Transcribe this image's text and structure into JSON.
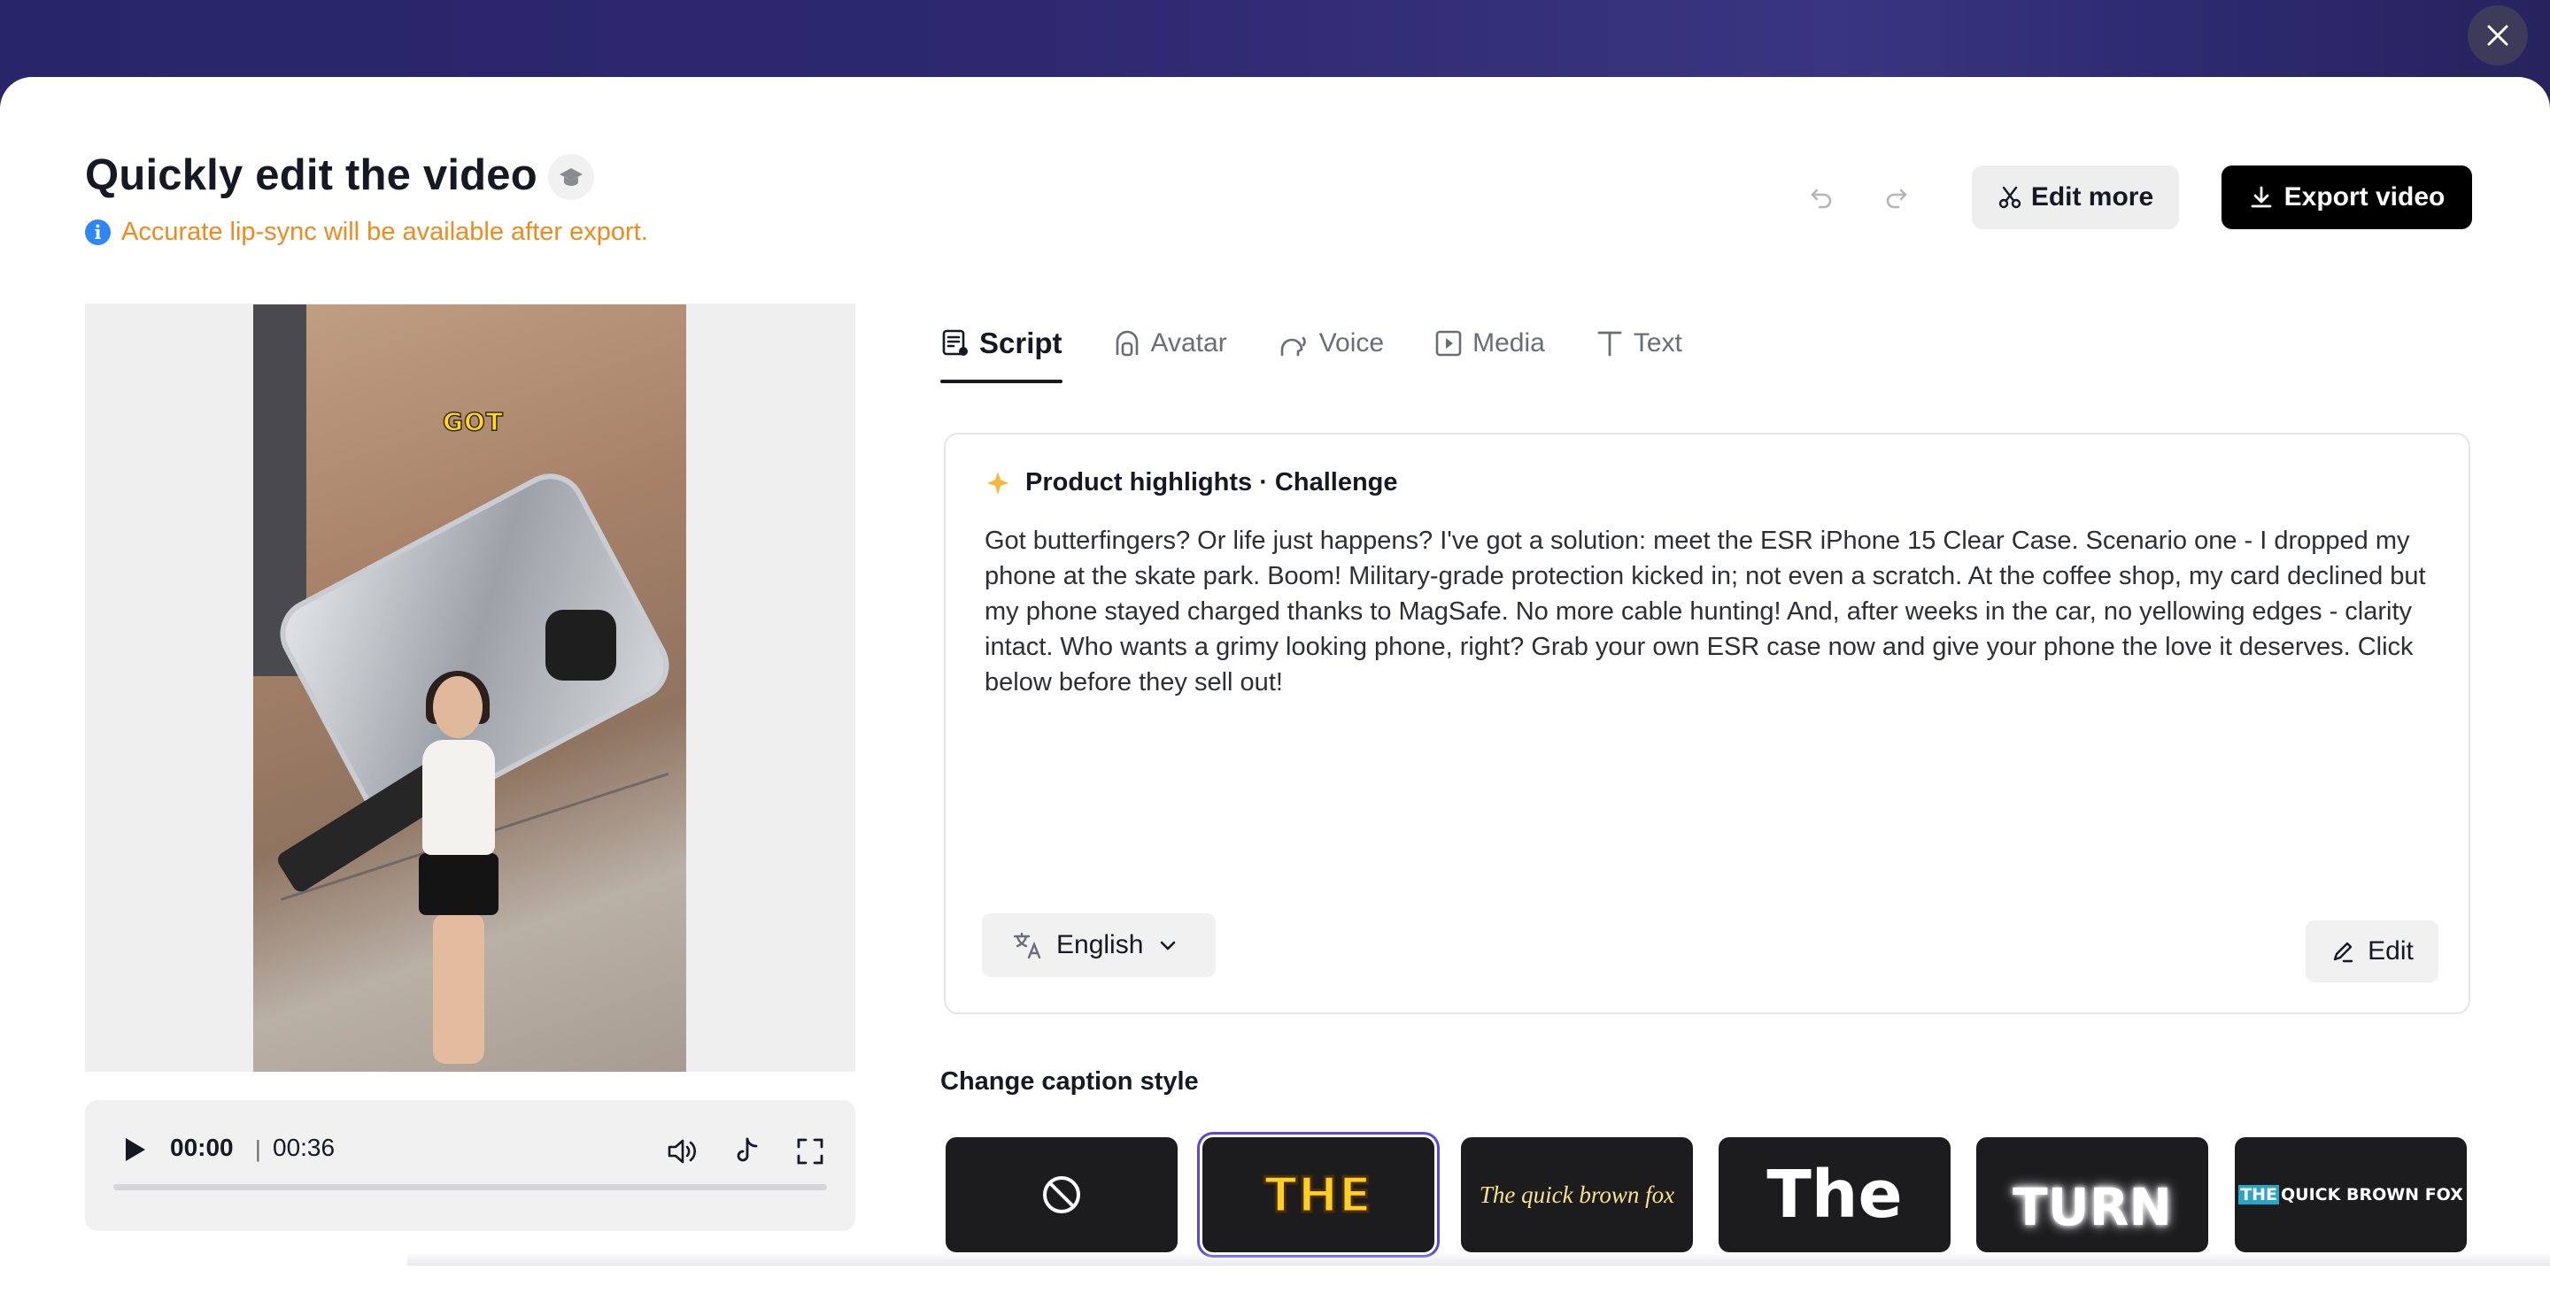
{
  "header": {
    "title": "Quickly edit the video",
    "notice": "Accurate lip-sync will be available after export.",
    "edit_more_label": "Edit more",
    "export_label": "Export video"
  },
  "preview": {
    "caption_word": "GOT",
    "current_time": "00:00",
    "separator": "|",
    "duration": "00:36",
    "progress": 0
  },
  "tabs": [
    {
      "label": "Script",
      "icon": "script-icon",
      "active": true
    },
    {
      "label": "Avatar",
      "icon": "avatar-icon",
      "active": false
    },
    {
      "label": "Voice",
      "icon": "voice-icon",
      "active": false
    },
    {
      "label": "Media",
      "icon": "media-icon",
      "active": false
    },
    {
      "label": "Text",
      "icon": "text-icon",
      "active": false
    }
  ],
  "script": {
    "heading": "Product highlights · Challenge",
    "body": "Got butterfingers? Or life just happens? I've got a solution: meet the ESR iPhone 15 Clear Case. Scenario one - I dropped my phone at the skate park. Boom! Military-grade protection kicked in; not even a scratch. At the coffee shop, my card declined but my phone stayed charged thanks to MagSafe. No more cable hunting! And, after weeks in the car, no yellowing edges - clarity intact. Who wants a grimy looking phone, right? Grab your own ESR case now and give your phone the love it deserves. Click below before they sell out!",
    "language": "English",
    "edit_label": "Edit"
  },
  "captions": {
    "section_title": "Change caption style",
    "styles": [
      {
        "id": "none",
        "preview": ""
      },
      {
        "id": "yellow-bold",
        "preview": "THE",
        "selected": true
      },
      {
        "id": "italic",
        "preview": "The quick brown fox"
      },
      {
        "id": "white-bold",
        "preview": "The"
      },
      {
        "id": "glow",
        "preview": "TURN"
      },
      {
        "id": "highlight",
        "preview_hl": "THE",
        "preview_rest": "QUICK BROWN FOX"
      }
    ]
  },
  "colors": {
    "accent_selected": "#5a46e6",
    "notice": "#f08a1c",
    "info": "#2f86f6"
  }
}
